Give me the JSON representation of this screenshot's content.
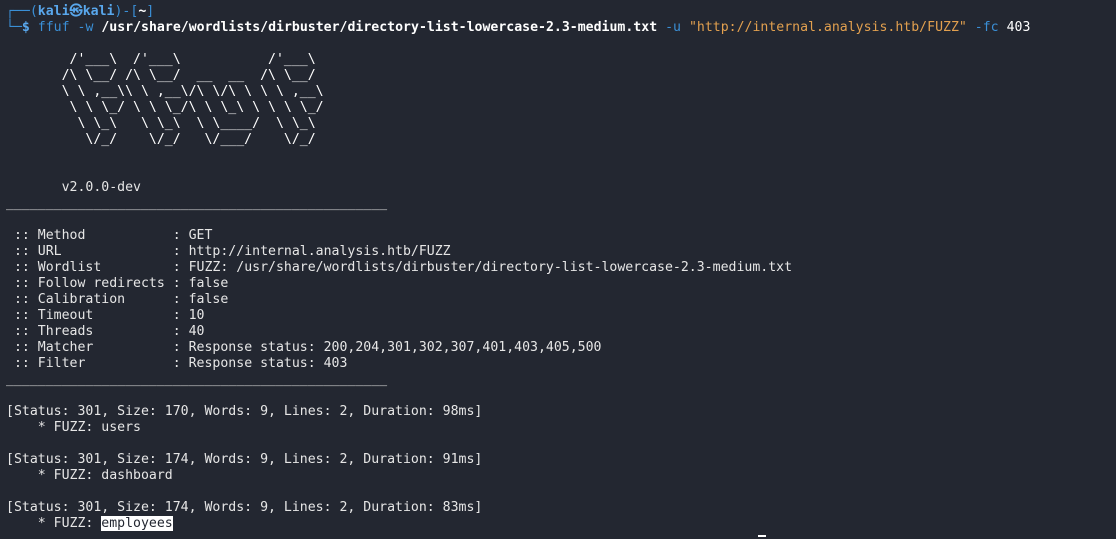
{
  "prompt": {
    "line1_prefix": "┌──(",
    "user": "kali",
    "at_symbol": "㉿",
    "host": "kali",
    "mid": ")-[",
    "path": "~",
    "end": "]",
    "line2_prefix": "└─",
    "dollar": "$"
  },
  "command": {
    "program": "ffuf",
    "flag_w": "-w",
    "wordlist_path": "/usr/share/wordlists/dirbuster/directory-list-lowercase-2.3-medium.txt",
    "flag_u": "-u",
    "url": "\"http://internal.analysis.htb/FUZZ\"",
    "flag_fc": "-fc",
    "fc_value": "403"
  },
  "banner": {
    "ascii_lines": [
      "        /'___\\  /'___\\           /'___\\",
      "       /\\ \\__/ /\\ \\__/  __  __  /\\ \\__/",
      "       \\ \\ ,__\\\\ \\ ,__\\/\\ \\/\\ \\ \\ \\ ,__\\",
      "        \\ \\ \\_/ \\ \\ \\_/\\ \\ \\_\\ \\ \\ \\ \\_/",
      "         \\ \\_\\   \\ \\_\\  \\ \\____/  \\ \\_\\",
      "          \\/_/    \\/_/   \\/___/    \\/_/"
    ],
    "version": "       v2.0.0-dev",
    "rule": "________________________________________________"
  },
  "config": [
    {
      "key": " :: Method           ",
      "value": ": GET"
    },
    {
      "key": " :: URL              ",
      "value": ": http://internal.analysis.htb/FUZZ"
    },
    {
      "key": " :: Wordlist         ",
      "value": ": FUZZ: /usr/share/wordlists/dirbuster/directory-list-lowercase-2.3-medium.txt"
    },
    {
      "key": " :: Follow redirects ",
      "value": ": false"
    },
    {
      "key": " :: Calibration      ",
      "value": ": false"
    },
    {
      "key": " :: Timeout          ",
      "value": ": 10"
    },
    {
      "key": " :: Threads          ",
      "value": ": 40"
    },
    {
      "key": " :: Matcher          ",
      "value": ": Response status: 200,204,301,302,307,401,403,405,500"
    },
    {
      "key": " :: Filter           ",
      "value": ": Response status: 403"
    }
  ],
  "results": [
    {
      "status_line": "[Status: 301, Size: 170, Words: 9, Lines: 2, Duration: 98ms]",
      "fuzz_prefix": "    * FUZZ: ",
      "fuzz_value": "users"
    },
    {
      "status_line": "[Status: 301, Size: 174, Words: 9, Lines: 2, Duration: 91ms]",
      "fuzz_prefix": "    * FUZZ: ",
      "fuzz_value": "dashboard"
    },
    {
      "status_line": "[Status: 301, Size: 174, Words: 9, Lines: 2, Duration: 83ms]",
      "fuzz_prefix": "    * FUZZ: ",
      "fuzz_value": "employees"
    }
  ]
}
